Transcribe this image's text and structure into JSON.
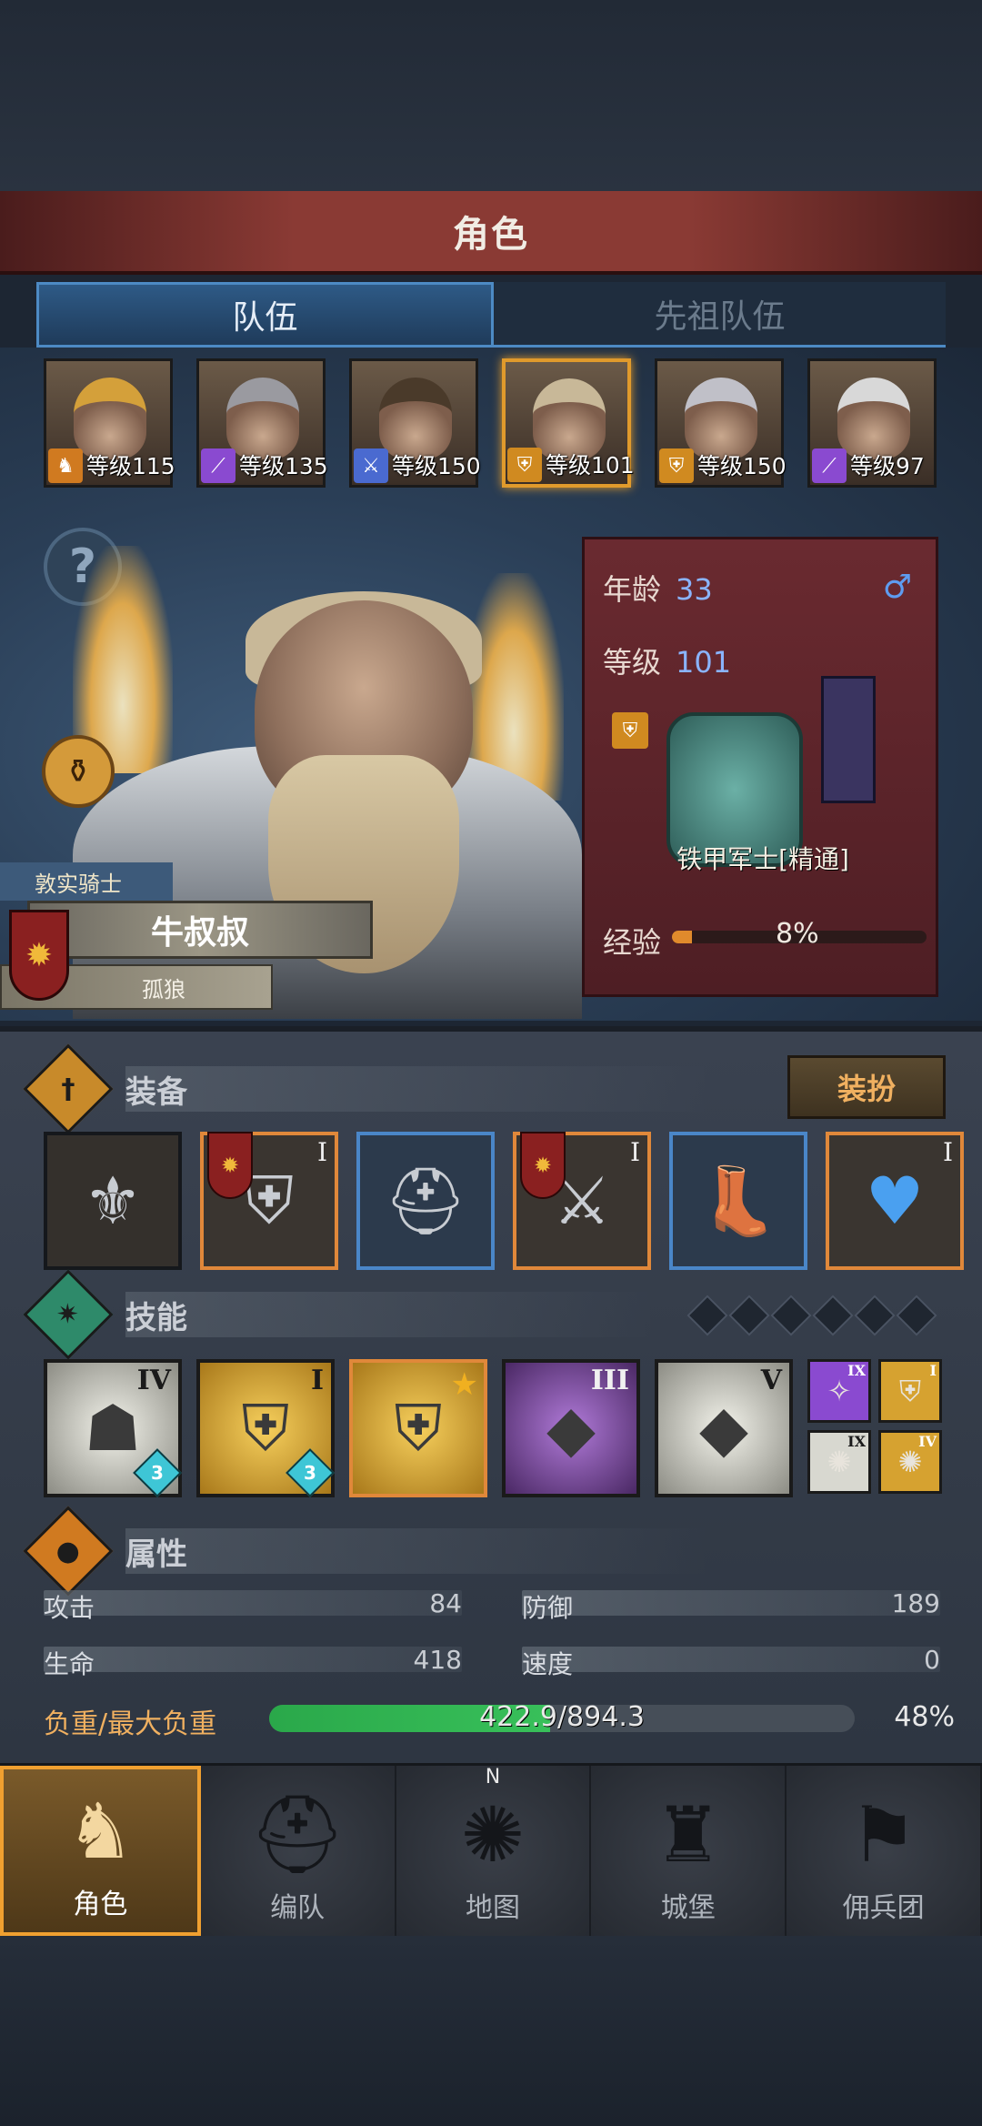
{
  "header": {
    "title": "角色"
  },
  "tabs": [
    {
      "label": "队伍",
      "active": true
    },
    {
      "label": "先祖队伍",
      "active": false
    }
  ],
  "roster": [
    {
      "level_text": "等级115",
      "class_icon": "horse-icon",
      "class_color": "#d07a20",
      "hair": "#d4a03a",
      "selected": false
    },
    {
      "level_text": "等级135",
      "class_icon": "staff-icon",
      "class_color": "#8a4ad0",
      "hair": "#9a9aa0",
      "selected": false
    },
    {
      "level_text": "等级150",
      "class_icon": "sword-icon",
      "class_color": "#4a6ad0",
      "hair": "#4a3a2a",
      "selected": false
    },
    {
      "level_text": "等级101",
      "class_icon": "shield-icon",
      "class_color": "#d08a20",
      "hair": "#c8b898",
      "selected": true
    },
    {
      "level_text": "等级150",
      "class_icon": "shield-icon",
      "class_color": "#d08a20",
      "hair": "#c0c0c8",
      "selected": false
    },
    {
      "level_text": "等级97",
      "class_icon": "staff-icon",
      "class_color": "#8a4ad0",
      "hair": "#d8d8d8",
      "selected": false
    }
  ],
  "character": {
    "title": "敦实骑士",
    "name": "牛叔叔",
    "trait": "孤狼",
    "age_label": "年龄",
    "age": "33",
    "gender_symbol": "♂",
    "level_label": "等级",
    "level": "101",
    "unit_name": "铁甲军士[精通]",
    "exp_label": "经验",
    "exp_percent": 8,
    "exp_text": "8%"
  },
  "equipment": {
    "title": "装备",
    "dress_button": "装扮",
    "slots": [
      {
        "name": "banner-item",
        "icon": "⚜",
        "rarity": "none",
        "rank": "",
        "badge": false
      },
      {
        "name": "shield-item",
        "icon": "⛨",
        "rarity": "orange",
        "rank": "I",
        "badge": true
      },
      {
        "name": "helmet-item",
        "icon": "⛑",
        "rarity": "blue",
        "rank": "",
        "badge": false
      },
      {
        "name": "armor-item",
        "icon": "⚔",
        "rarity": "orange",
        "rank": "I",
        "badge": true
      },
      {
        "name": "boots-item",
        "icon": "👢",
        "rarity": "blue",
        "rank": "",
        "badge": false
      },
      {
        "name": "amulet-item",
        "icon": "♥",
        "rarity": "orange",
        "rank": "I",
        "badge": false
      }
    ]
  },
  "skills": {
    "title": "技能",
    "slots": [
      {
        "rank": "IV",
        "level": "3",
        "color": "white",
        "icon": "☗"
      },
      {
        "rank": "I",
        "level": "3",
        "color": "gold",
        "icon": "⛨"
      },
      {
        "rank": "",
        "level": "",
        "color": "gold",
        "icon": "⛨",
        "starred": true
      },
      {
        "rank": "III",
        "level": "",
        "color": "purple",
        "icon": "◆"
      },
      {
        "rank": "V",
        "level": "",
        "color": "white",
        "icon": "◆"
      }
    ],
    "mini": [
      {
        "rank": "IX",
        "bg": "#8a4ad0",
        "icon": "✧"
      },
      {
        "rank": "I",
        "bg": "#d6a230",
        "icon": "⛨"
      },
      {
        "rank": "IX",
        "bg": "#d8d8d0",
        "icon": "✺"
      },
      {
        "rank": "IV",
        "bg": "#d6a230",
        "icon": "✺"
      }
    ]
  },
  "attributes": {
    "title": "属性",
    "attack_label": "攻击",
    "attack": "84",
    "defense_label": "防御",
    "defense": "189",
    "hp_label": "生命",
    "hp": "418",
    "speed_label": "速度",
    "speed": "0",
    "load_label": "负重/最大负重",
    "load_text": "422.9/894.3",
    "load_percent": 48,
    "load_pct_text": "48%"
  },
  "nav": [
    {
      "label": "角色",
      "icon": "knight-icon",
      "glyph": "♞",
      "active": true
    },
    {
      "label": "编队",
      "icon": "helmet-icon",
      "glyph": "⛑",
      "active": false
    },
    {
      "label": "地图",
      "icon": "compass-icon",
      "glyph": "✺",
      "active": false,
      "north": "N"
    },
    {
      "label": "城堡",
      "icon": "castle-icon",
      "glyph": "♜",
      "active": false
    },
    {
      "label": "佣兵团",
      "icon": "banner-icon",
      "glyph": "⚑",
      "active": false
    }
  ]
}
